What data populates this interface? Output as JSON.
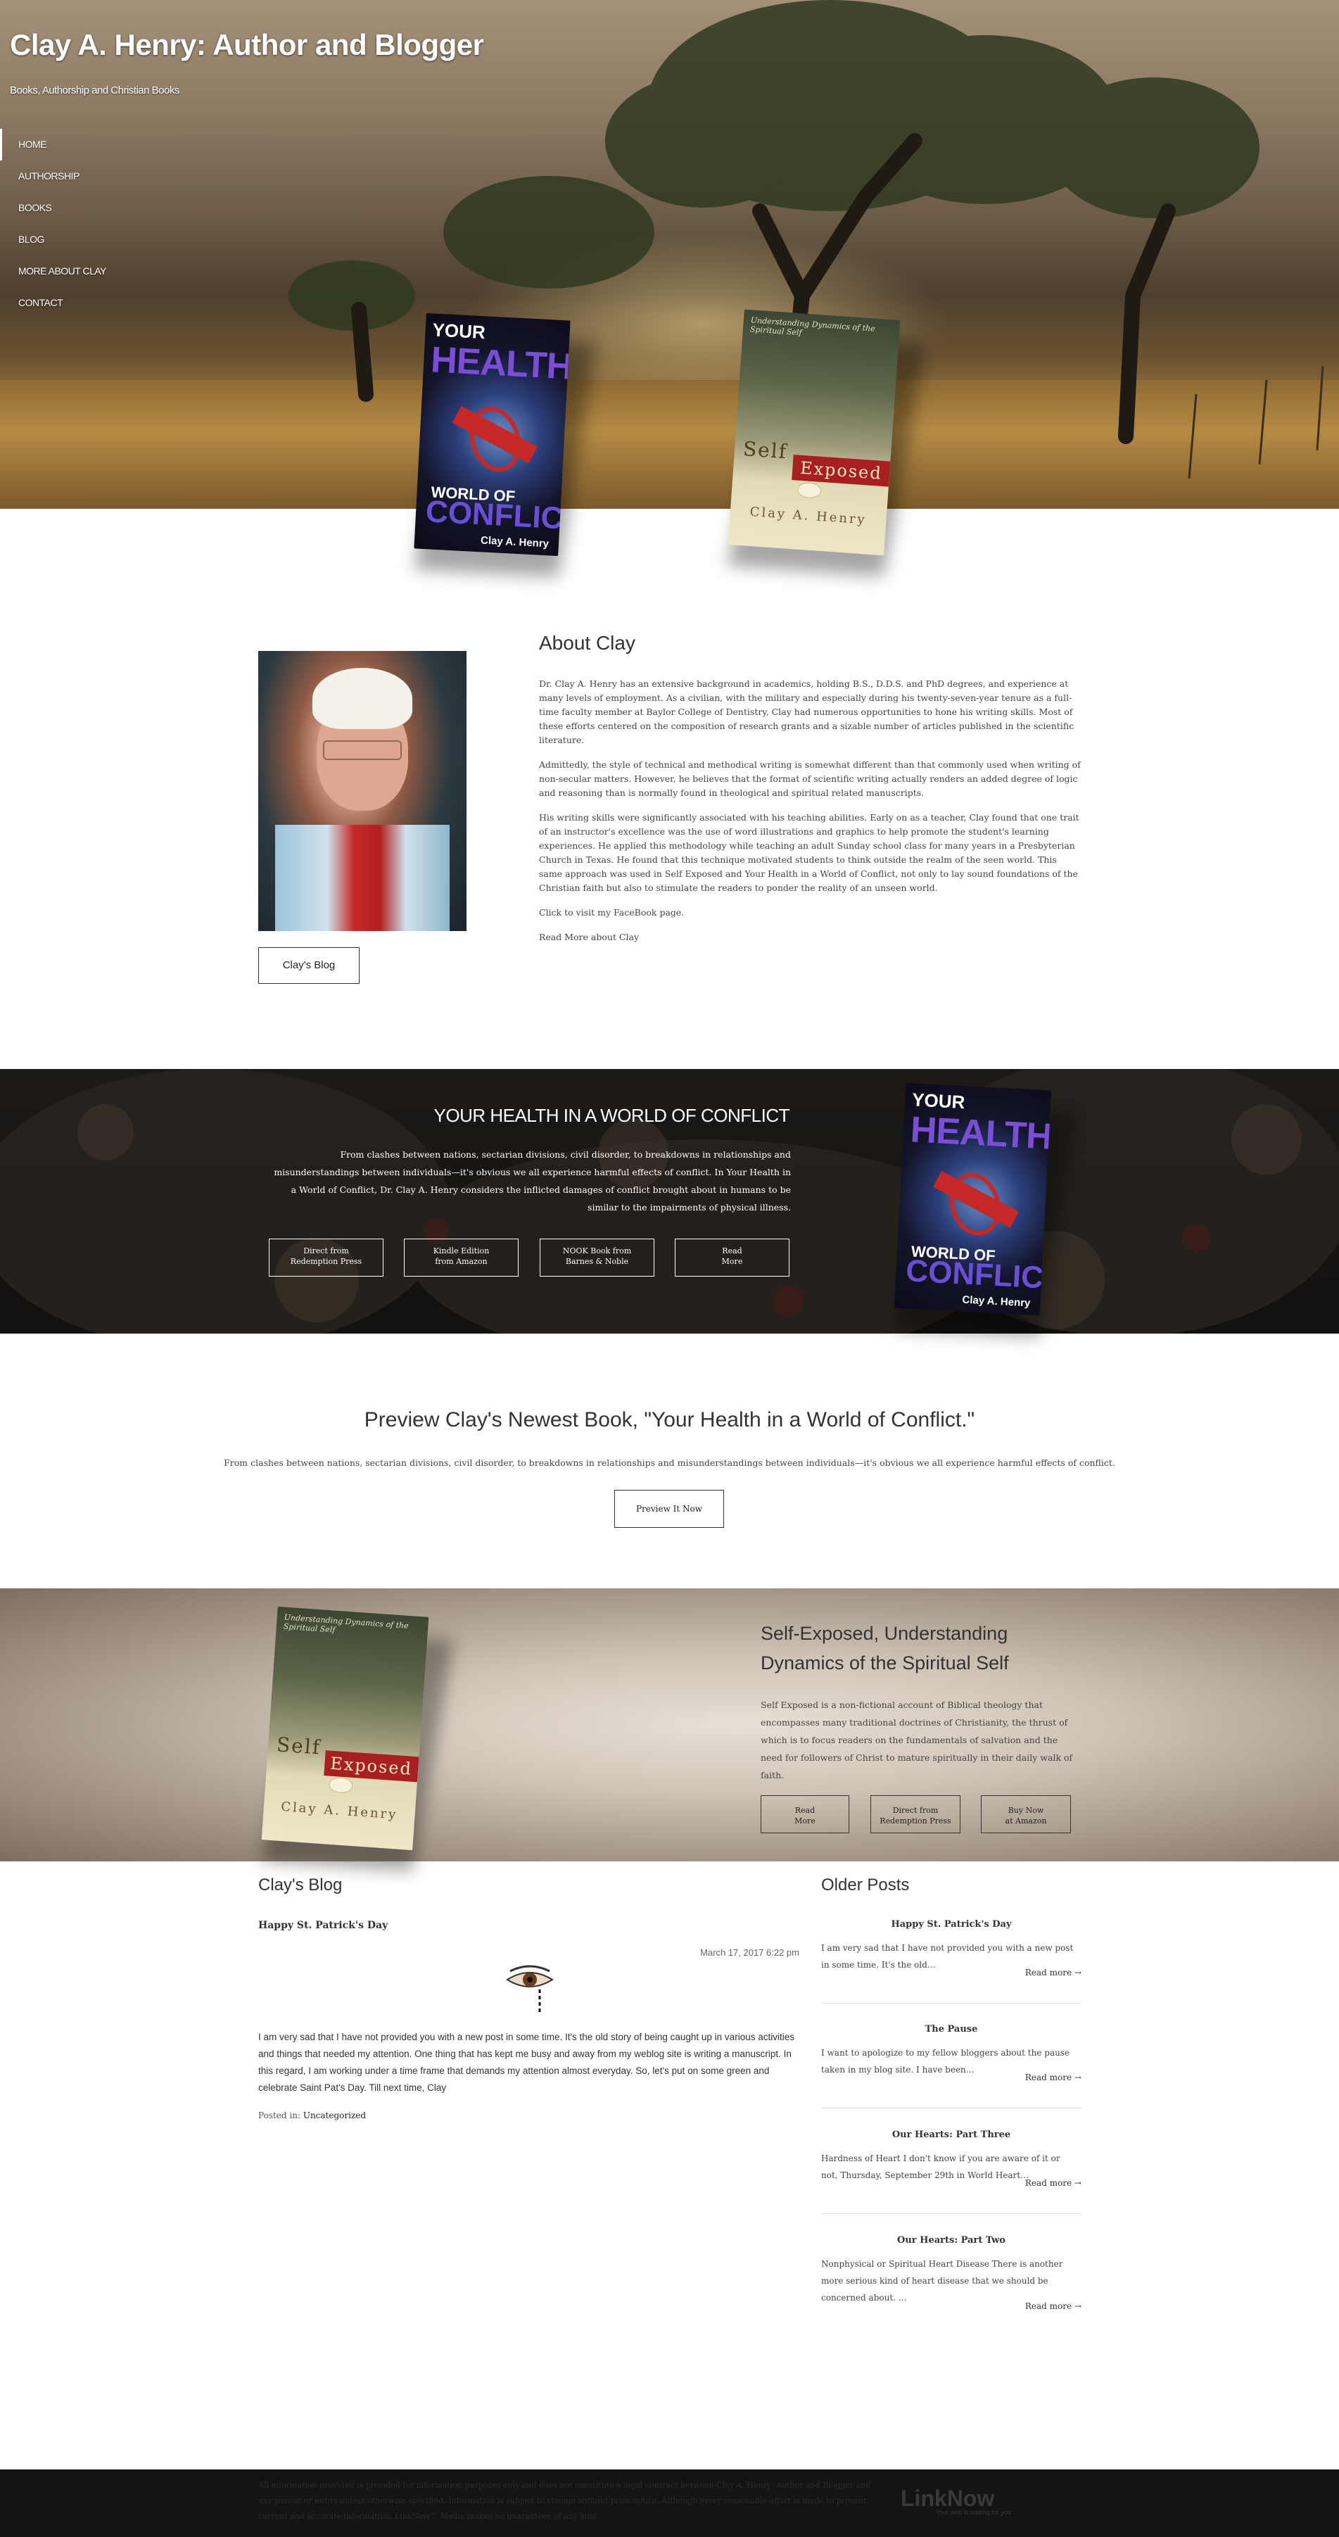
{
  "site": {
    "title": "Clay A. Henry: Author and Blogger",
    "tagline": "Books, Authorship and Christian Books"
  },
  "nav": {
    "items": [
      "HOME",
      "AUTHORSHIP",
      "BOOKS",
      "BLOG",
      "MORE ABOUT CLAY",
      "CONTACT"
    ]
  },
  "books": {
    "health": {
      "line1": "YOUR",
      "line2": "HEALTH",
      "line3": "WORLD OF",
      "line4": "CONFLICT",
      "author": "Clay A. Henry"
    },
    "self": {
      "top": "Understanding Dynamics of the Spiritual Self",
      "word1": "Self",
      "word2": "Exposed",
      "author": "Clay A. Henry"
    }
  },
  "about": {
    "heading": "About Clay",
    "blog_button": "Clay's Blog",
    "paragraphs": [
      "Dr. Clay A. Henry has an extensive background in academics, holding B.S., D.D.S. and PhD degrees, and experience at many levels of employment. As a civilian, with the military and especially during his twenty-seven-year tenure as a full-time faculty member at Baylor College of Dentistry, Clay had numerous opportunities to hone his writing skills. Most of these efforts centered on the composition of research grants and a sizable number of articles published in the scientific literature.",
      "Admittedly, the style of technical and methodical writing is somewhat different than that commonly used when writing of non-secular matters. However, he believes that the format of scientific writing actually renders an added degree of logic and reasoning than is normally found in theological and spiritual related manuscripts.",
      "His writing skills were significantly associated with his teaching abilities. Early on as a teacher, Clay found that one trait of an instructor's excellence was the use of word illustrations and graphics to help promote the student's learning experiences. He applied this methodology while teaching an adult Sunday school class for many years in a Presbyterian Church in Texas. He found that this technique motivated students to think outside the realm of the seen world. This same approach was used in Self Exposed and Your Health in a World of Conflict, not only to lay sound foundations of the Christian faith but also to stimulate the readers to ponder the reality of an unseen world.",
      "Click to visit my FaceBook page.",
      "Read More about Clay"
    ]
  },
  "health_section": {
    "heading": "YOUR HEALTH IN A WORLD OF CONFLICT",
    "text": "From clashes between nations, sectarian divisions, civil disorder, to breakdowns in relationships and misunderstandings between individuals—it's obvious we all experience harmful effects of conflict. In Your Health in a World of Conflict, Dr. Clay A. Henry considers the inflicted damages of conflict brought about in humans to be similar to the impairments of physical illness.",
    "buttons": [
      {
        "l1": "Direct from",
        "l2": "Redemption Press"
      },
      {
        "l1": "Kindle Edition",
        "l2": "from Amazon"
      },
      {
        "l1": "NOOK Book from",
        "l2": "Barnes & Noble"
      },
      {
        "l1": "Read",
        "l2": "More"
      }
    ]
  },
  "preview": {
    "heading": "Preview Clay's Newest Book, \"Your Health in a World of Conflict.\"",
    "text": "From clashes between nations, sectarian divisions, civil disorder, to breakdowns in relationships and misunderstandings between individuals—it's obvious we all experience harmful effects of conflict.",
    "button": "Preview It Now"
  },
  "self_section": {
    "heading": "Self-Exposed, Understanding Dynamics of the Spiritual Self",
    "text": "Self Exposed is a non-fictional account of Biblical theology that encompasses many traditional doctrines of Christianity, the thrust of which is to focus readers on the fundamentals of salvation and the need for followers of Christ to mature spiritually in their daily walk of faith.",
    "buttons": [
      {
        "l1": "Read",
        "l2": "More"
      },
      {
        "l1": "Direct from",
        "l2": "Redemption Press"
      },
      {
        "l1": "Buy Now",
        "l2": "at Amazon"
      }
    ]
  },
  "blog": {
    "heading": "Clay's Blog",
    "post_title": "Happy St. Patrick's Day",
    "date": "March 17, 2017 6:22 pm",
    "body": "I am very sad that I have not provided you with a new post in some time. It's the old story of being caught up in various activities  and things that needed my attention. One thing that has kept me busy and away from my weblog site is writing a manuscript. In this regard, I am working under a time frame that demands my attention almost everyday. So, let's put on some green and celebrate Saint Pat's Day. Till next time, Clay",
    "posted_label": "Posted in:",
    "category": "Uncategorized"
  },
  "older": {
    "heading": "Older Posts",
    "read_more": "Read more →",
    "posts": [
      {
        "title": "Happy St. Patrick's Day",
        "excerpt": "I am very sad that I have not provided you with a new post in some time. It's the old…"
      },
      {
        "title": "The Pause",
        "excerpt": "  I want to apologize to my fellow bloggers about the pause taken in my blog site. I have been…"
      },
      {
        "title": "Our Hearts: Part Three",
        "excerpt": "Hardness of Heart I don't know if you are aware of it or not, Thursday, September 29th in World Heart…"
      },
      {
        "title": "Our Hearts: Part Two",
        "excerpt": "Nonphysical or Spiritual Heart Disease There is another more serious kind of heart disease that we should be concerned about. …"
      }
    ]
  },
  "footer": {
    "text": "All information provided is provided for information purposes only and does not constitute a legal contract between Clay A. Henry: Author and Blogger and any person or entity unless otherwise specified. Information is subject to change without prior notice. Although every reasonable effort is made to present current and accurate information, LinkNow™ Media makes no guarantees of any kind.",
    "logo": "LinkNow",
    "logo_sub": "Your web is waiting for you"
  },
  "colors": {
    "accent_red": "#a81f1f",
    "footer_bg": "#141414"
  }
}
